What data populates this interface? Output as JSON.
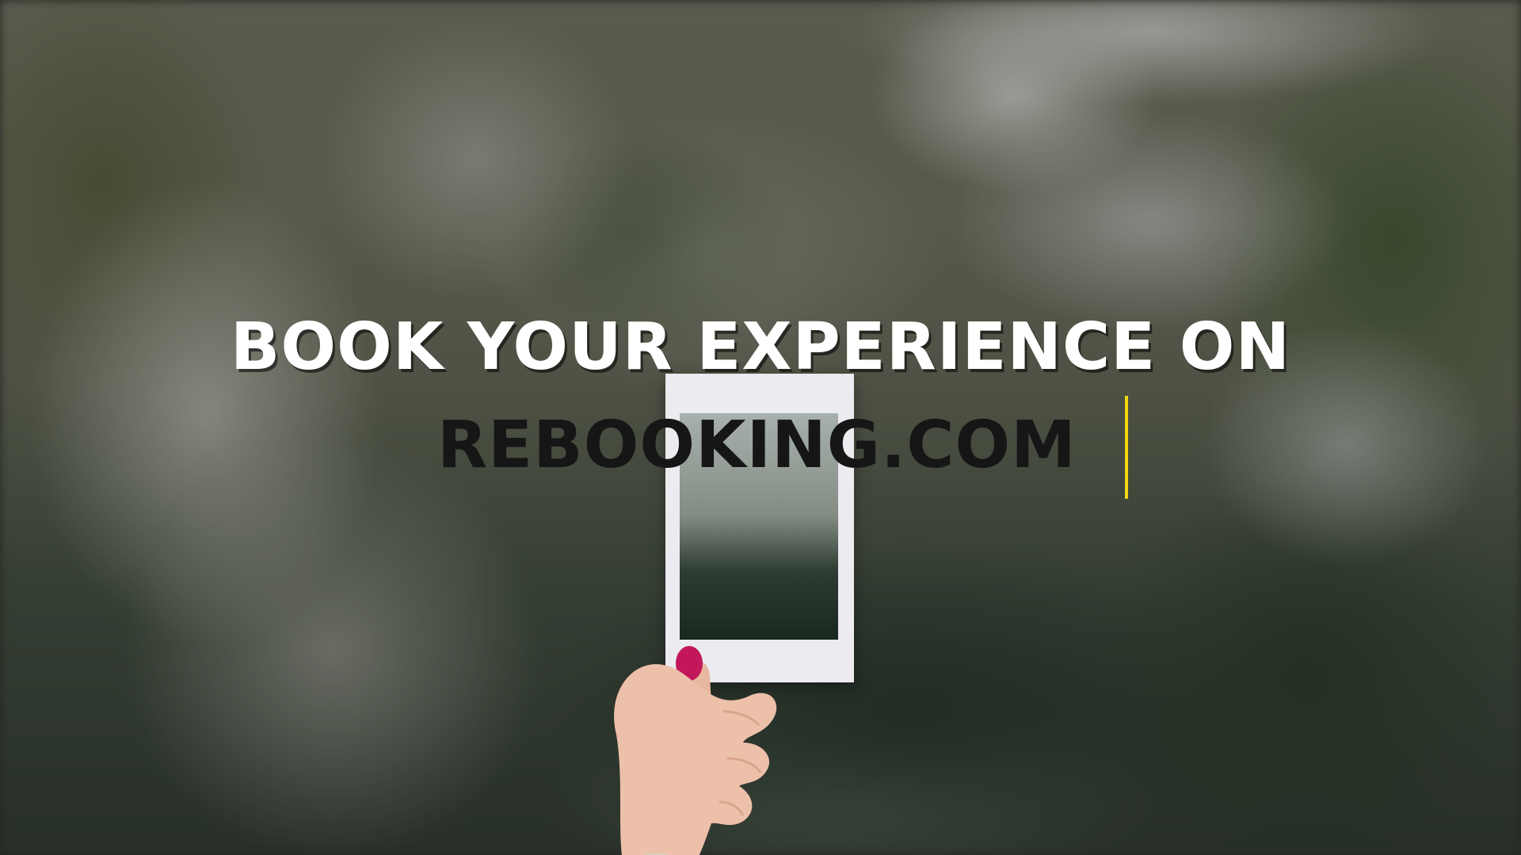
{
  "hero": {
    "headline": "BOOK YOUR EXPERIENCE ON",
    "typed_text": "REBOOKING.COM"
  },
  "colors": {
    "headline": "#ffffff",
    "typed_text": "#161616",
    "caret": "#f2d70f",
    "nail_polish": "#c2185b"
  },
  "icons": {
    "caret": "text-cursor-icon"
  }
}
